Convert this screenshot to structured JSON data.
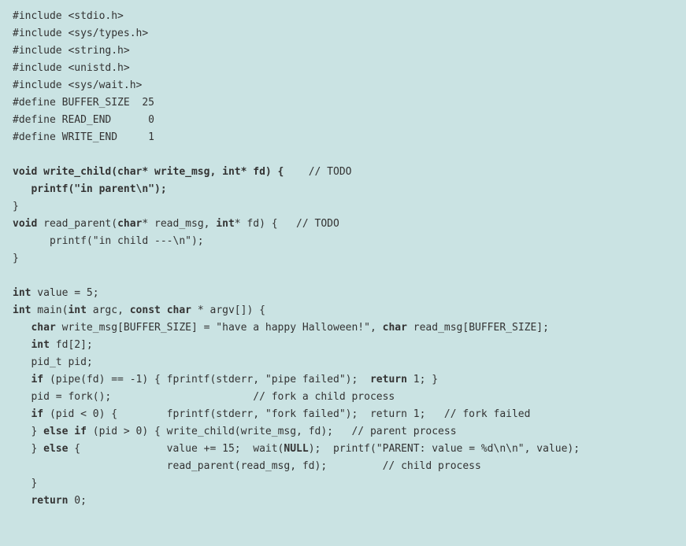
{
  "code": {
    "l1": "#include <stdio.h>",
    "l2": "#include <sys/types.h>",
    "l3": "#include <string.h>",
    "l4": "#include <unistd.h>",
    "l5": "#include <sys/wait.h>",
    "l6": "#define BUFFER_SIZE  25",
    "l7": "#define READ_END      0",
    "l8": "#define WRITE_END     1",
    "l9a": "void",
    "l9b": " write_child(char* write_msg, int* fd) {",
    "l9c": "    // TODO",
    "l10a": "   printf(\"in parent\\n\");",
    "l11": "}",
    "l12a": "void",
    "l12b": " read_parent(",
    "l12c": "char",
    "l12d": "* read_msg, ",
    "l12e": "int",
    "l12f": "* fd) {   // TODO",
    "l13": "      printf(\"in child ---\\n\");",
    "l14": "}",
    "l15a": "int",
    "l15b": " value = 5;",
    "l16a": "int",
    "l16b": " main(",
    "l16c": "int",
    "l16d": " argc, ",
    "l16e": "const char",
    "l16f": " * argv[]) {",
    "l17a": "   char",
    "l17b": " write_msg[BUFFER_SIZE] = \"have a happy Halloween!\", ",
    "l17c": "char",
    "l17d": " read_msg[BUFFER_SIZE];",
    "l18a": "   int",
    "l18b": " fd[2];",
    "l19": "   pid_t pid;",
    "l20a": "   if",
    "l20b": " (pipe(fd) == -1) { fprintf(stderr, \"pipe failed\");  ",
    "l20c": "return",
    "l20d": " 1; }",
    "l21": "   pid = fork();                       // fork a child process",
    "l22a": "   if",
    "l22b": " (pid < 0) {        fprintf(stderr, \"fork failed\");  return 1;   // fork failed",
    "l23a": "   } ",
    "l23b": "else if",
    "l23c": " (pid > 0) { write_child(write_msg, fd);   // parent process",
    "l24a": "   } ",
    "l24b": "else",
    "l24c": " {              value += 15;  wait(",
    "l24d": "NULL",
    "l24e": ");  printf(\"PARENT: value = %d\\n\\n\", value);",
    "l25": "                         read_parent(read_msg, fd);         // child process",
    "l26": "   }",
    "l27a": "   return",
    "l27b": " 0;"
  }
}
